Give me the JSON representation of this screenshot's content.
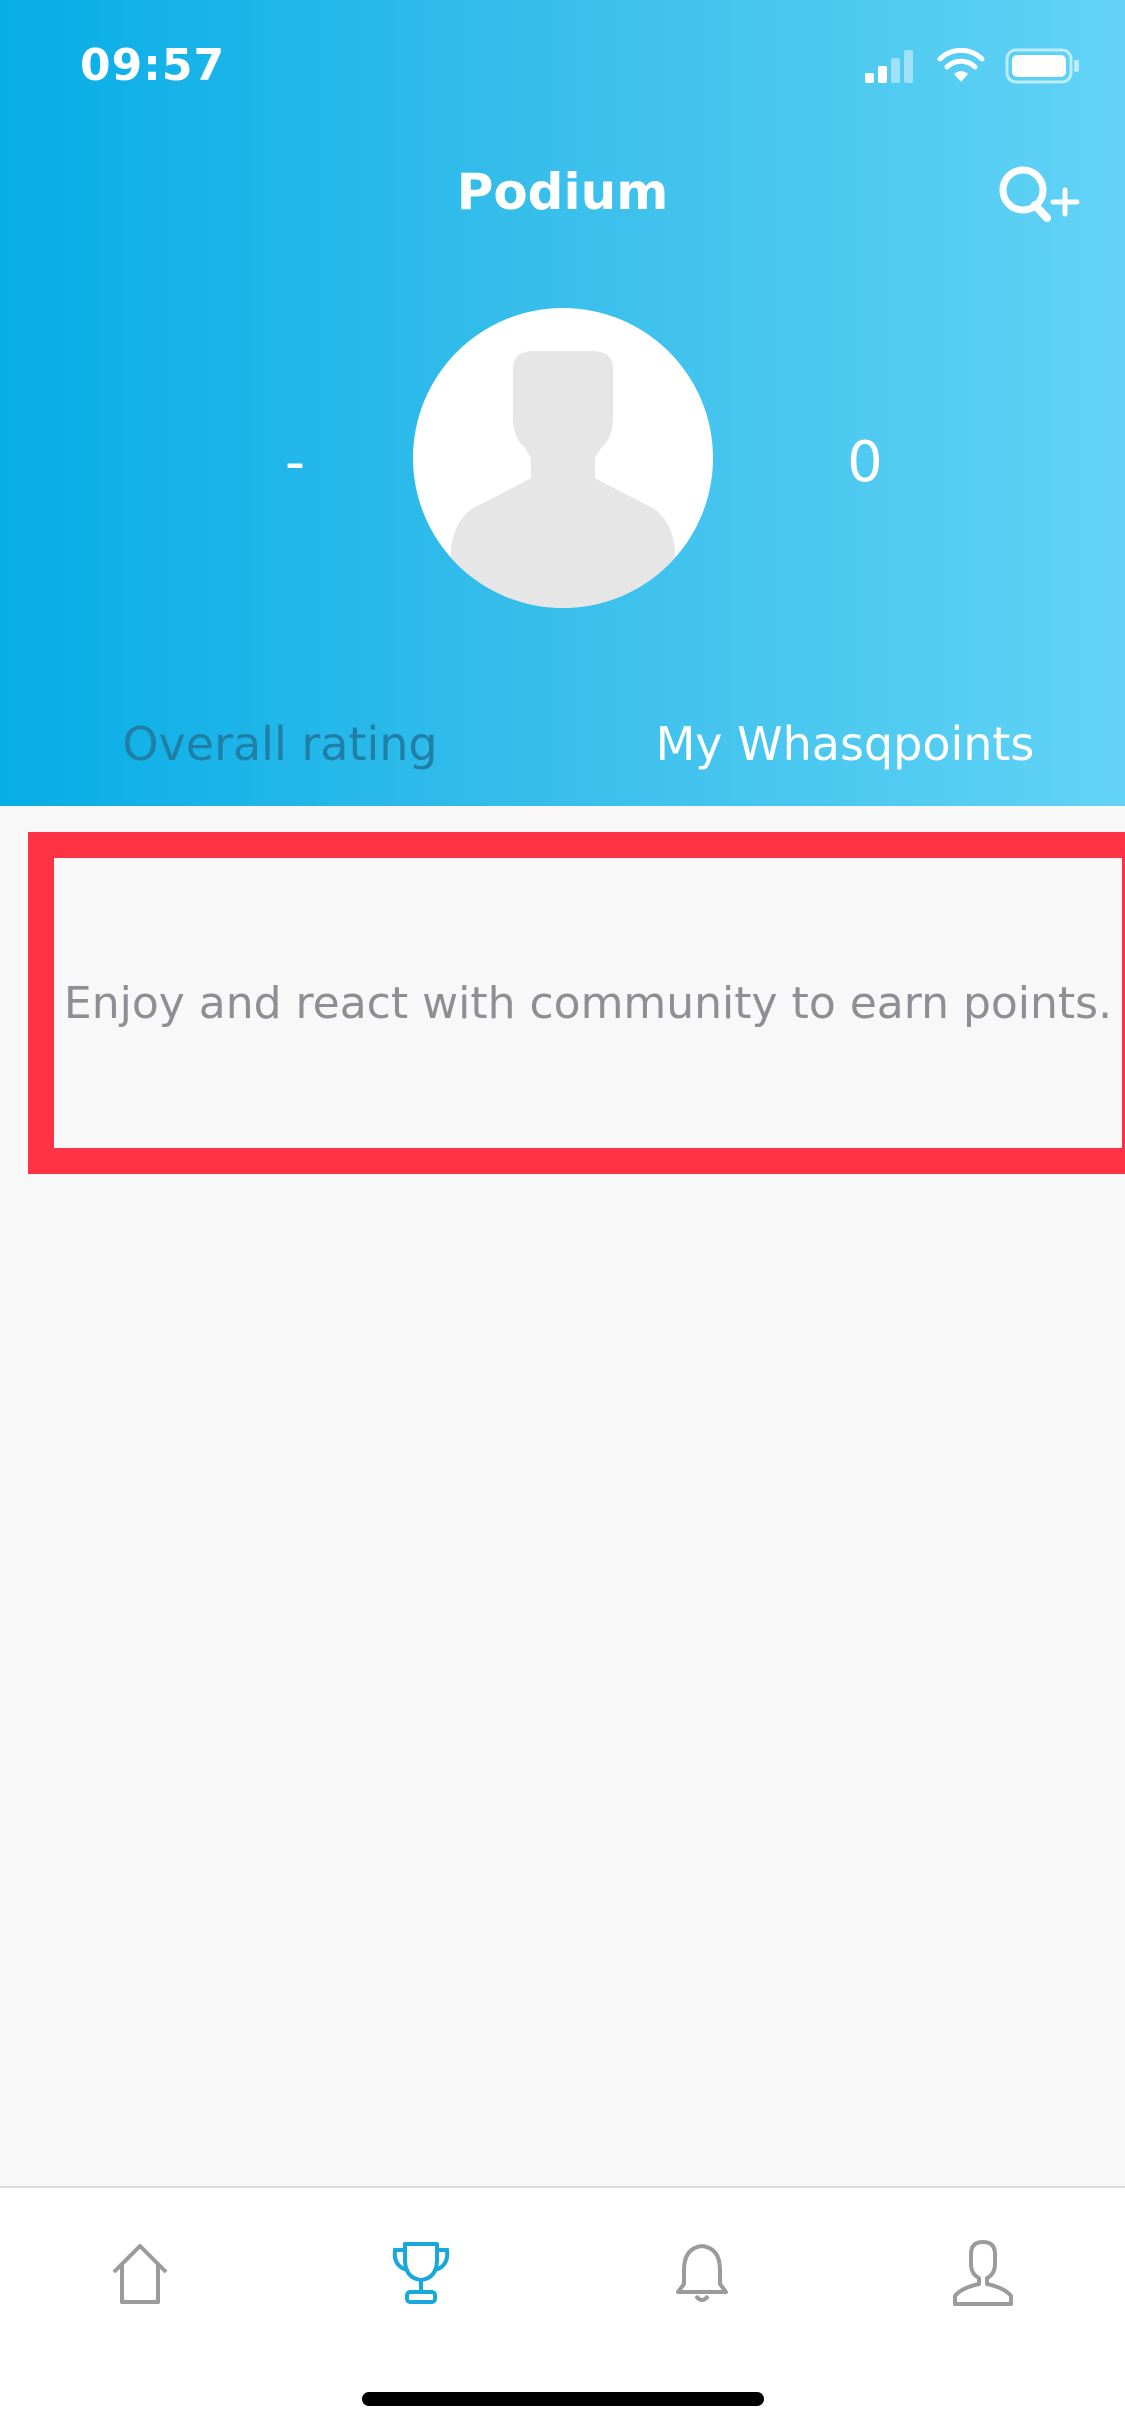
{
  "status_bar": {
    "time": "09:57"
  },
  "header": {
    "title": "Podium",
    "overall_rating_value": "-",
    "whasqpoints_value": "0",
    "overall_rating_label": "Overall rating",
    "whasqpoints_label": "My Whasqpoints"
  },
  "message": {
    "text": "Enjoy and react with community to earn points."
  },
  "tabbar": {
    "items": [
      {
        "icon": "home-icon",
        "active": false
      },
      {
        "icon": "trophy-icon",
        "active": true
      },
      {
        "icon": "bell-icon",
        "active": false
      },
      {
        "icon": "profile-icon",
        "active": false
      }
    ]
  },
  "colors": {
    "header_gradient_start": "#06ade7",
    "header_gradient_end": "#62d3f6",
    "accent": "#1aa8dc",
    "highlight_border": "#ff3344",
    "inactive_icon": "#9b9b9b"
  }
}
